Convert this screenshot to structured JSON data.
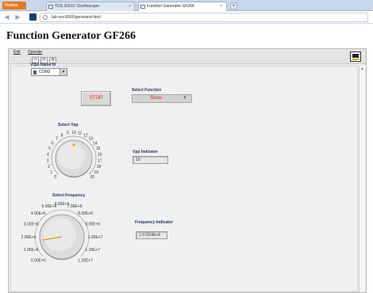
{
  "browser": {
    "menu_button": "Firefox",
    "tabs": [
      {
        "label": "TDS 2001C Oscilloscope",
        "close": "×"
      },
      {
        "label": "Function Generator GF266",
        "close": "×"
      }
    ],
    "new_tab": "+",
    "url": "lab-xxx:8000/generator.html"
  },
  "page": {
    "title": "Function Generator GF266"
  },
  "vi": {
    "menu": [
      "Edit",
      "Operate"
    ],
    "toolbar_icons": [
      "run-arrow-icon",
      "run-continuous-icon",
      "abort-icon"
    ],
    "visa": {
      "label": "VISA Name In",
      "value": "COM2"
    },
    "stop_label": "STOP",
    "function": {
      "label": "Select Function",
      "value": "Sinus"
    },
    "vpp_knob": {
      "label": "Select Vpp",
      "ticks": [
        "0",
        "1",
        "2",
        "3",
        "4",
        "5",
        "6",
        "7",
        "8",
        "9",
        "10",
        "11",
        "12",
        "13",
        "14",
        "15",
        "16",
        "17",
        "18",
        "19",
        "20"
      ],
      "value": 10
    },
    "vpp_indicator": {
      "label": "Vpp Indicator",
      "value": "10"
    },
    "freq_knob": {
      "label": "Select Frequency",
      "ticks": [
        "0.00E+0",
        "1.00E+6",
        "2.00E+6",
        "3.00E+6",
        "4.00E+6",
        "5.00E+6",
        "6.00E+6",
        "7.00E+6",
        "8.00E+6",
        "9.00E+6",
        "1.00E+7",
        "1.10E+7",
        "1.20E+7"
      ],
      "value": 1573240
    },
    "freq_indicator": {
      "label": "Frequency Indicator",
      "value": "1.57324E+6"
    },
    "colors": {
      "stop_text": "#d62b2b",
      "function_text": "#cf2222",
      "label_text": "#1c2f5a",
      "firefox_orange": "#e8781e"
    }
  }
}
